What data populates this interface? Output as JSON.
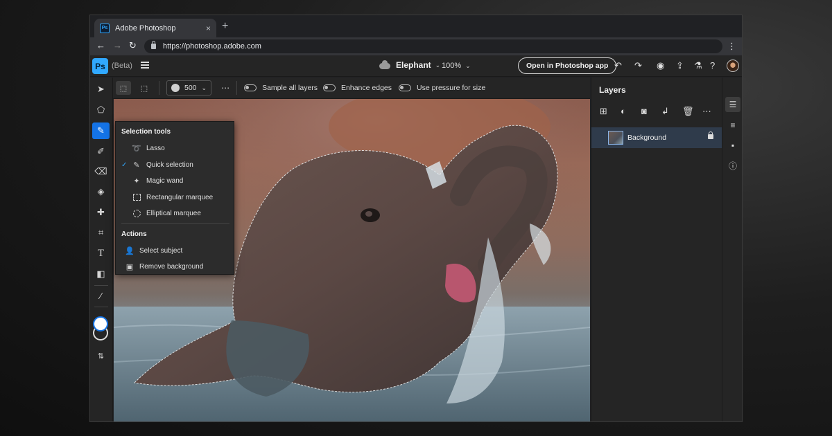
{
  "browser": {
    "tab_title": "Adobe Photoshop",
    "favicon_text": "Ps",
    "tab_close": "×",
    "new_tab": "+",
    "url": "https://photoshop.adobe.com"
  },
  "app": {
    "logo": "Ps",
    "beta_label": "(Beta)",
    "document_name": "Elephant",
    "zoom": "100%",
    "open_in_app_label": "Open in Photoshop app"
  },
  "tools": [
    {
      "name": "move-tool",
      "icon": "arrow-icon"
    },
    {
      "name": "transform-tool",
      "icon": "transform-icon"
    },
    {
      "name": "quick-selection-tool",
      "icon": "brush-selection-icon",
      "active": true
    },
    {
      "name": "brush-tool",
      "icon": "brush-icon"
    },
    {
      "name": "eraser-tool",
      "icon": "eraser-icon"
    },
    {
      "name": "paint-bucket-tool",
      "icon": "bucket-icon"
    },
    {
      "name": "healing-tool",
      "icon": "bandage-icon"
    },
    {
      "name": "crop-tool",
      "icon": "crop-icon"
    },
    {
      "name": "type-tool",
      "icon": "type-icon"
    },
    {
      "name": "shape-tool",
      "icon": "shapes-icon"
    },
    {
      "name": "eyedropper-tool",
      "icon": "eyedropper-icon"
    }
  ],
  "options_bar": {
    "brush_size": "500",
    "sample_all_layers": "Sample all layers",
    "enhance_edges": "Enhance edges",
    "use_pressure": "Use pressure for size"
  },
  "flyout": {
    "selection_heading": "Selection tools",
    "selection_items": [
      {
        "label": "Lasso",
        "icon": "lasso-icon",
        "checked": false
      },
      {
        "label": "Quick selection",
        "icon": "quick-selection-icon",
        "checked": true
      },
      {
        "label": "Magic wand",
        "icon": "magic-wand-icon",
        "checked": false
      },
      {
        "label": "Rectangular marquee",
        "icon": "rect-marquee-icon",
        "checked": false
      },
      {
        "label": "Elliptical marquee",
        "icon": "ellipse-marquee-icon",
        "checked": false
      }
    ],
    "actions_heading": "Actions",
    "action_items": [
      {
        "label": "Select subject",
        "icon": "person-icon"
      },
      {
        "label": "Remove background",
        "icon": "image-icon"
      }
    ]
  },
  "layers_panel": {
    "title": "Layers",
    "layers": [
      {
        "name": "Background",
        "locked": true,
        "selected": true
      }
    ]
  },
  "colors": {
    "accent": "#1473e6",
    "ps_blue": "#31a8ff",
    "panel": "#252525",
    "selected_layer": "#2f3b4b"
  }
}
